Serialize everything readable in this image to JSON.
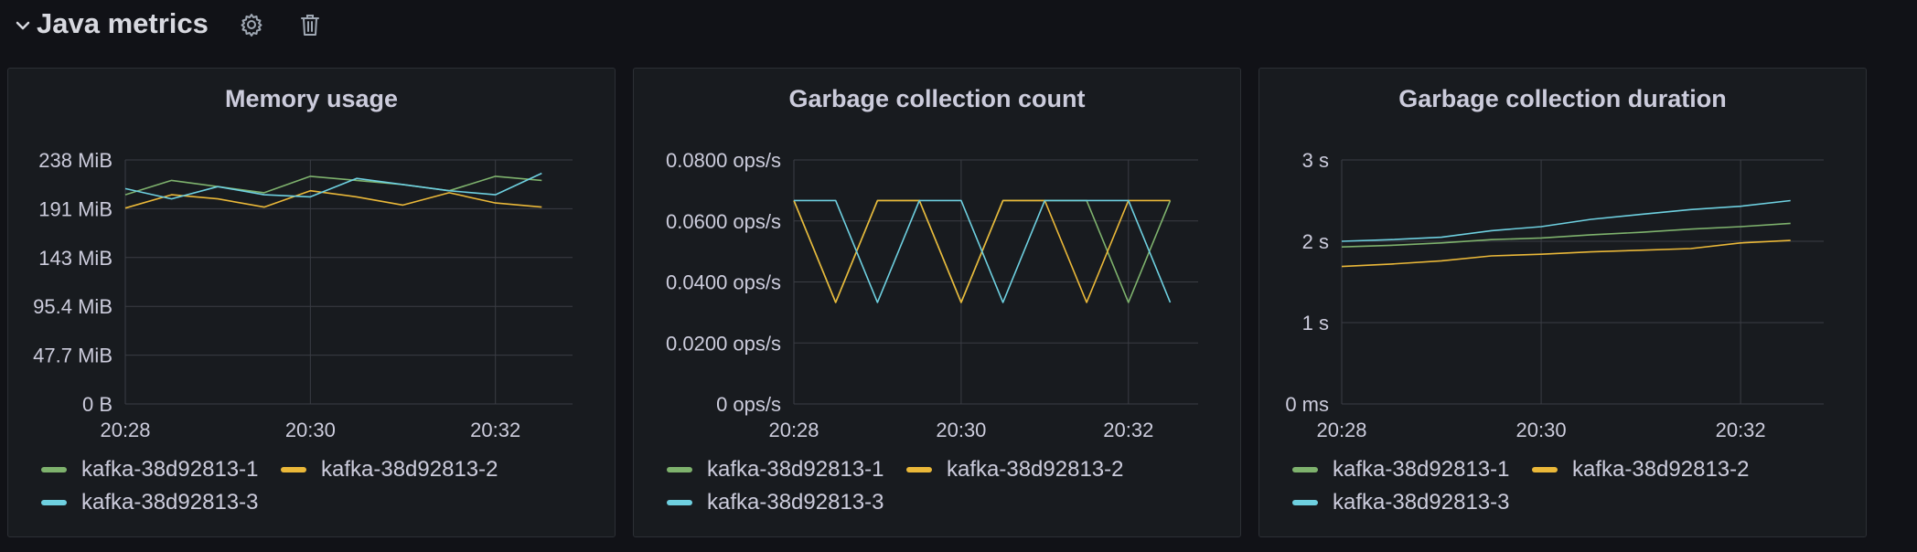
{
  "row": {
    "title": "Java metrics",
    "icons": [
      "chevron-down-icon",
      "gear-icon",
      "trash-icon"
    ]
  },
  "series_colors": [
    "#73bf69",
    "#f2cc0c",
    "#8ab8ff"
  ],
  "series_colors_actual": [
    "#7eb26d",
    "#eab839",
    "#6ed0e0"
  ],
  "panels": [
    {
      "title": "Memory usage",
      "legend": [
        "kafka-38d92813-1",
        "kafka-38d92813-2",
        "kafka-38d92813-3"
      ]
    },
    {
      "title": "Garbage collection count",
      "legend": [
        "kafka-38d92813-1",
        "kafka-38d92813-2",
        "kafka-38d92813-3"
      ]
    },
    {
      "title": "Garbage collection duration",
      "legend": [
        "kafka-38d92813-1",
        "kafka-38d92813-2",
        "kafka-38d92813-3"
      ]
    }
  ],
  "chart_data": [
    {
      "type": "line",
      "title": "Memory usage",
      "x_ticks": [
        "20:28",
        "20:30",
        "20:32"
      ],
      "y_ticks": [
        "0 B",
        "47.7 MiB",
        "95.4 MiB",
        "143 MiB",
        "191 MiB",
        "238 MiB"
      ],
      "ylim": [
        0,
        238
      ],
      "x_range": [
        "20:28",
        "20:32:30"
      ],
      "grid": true,
      "legend_position": "bottom",
      "x": [
        "20:28",
        "20:28:30",
        "20:29",
        "20:29:30",
        "20:30",
        "20:30:30",
        "20:31",
        "20:31:30",
        "20:32",
        "20:32:30"
      ],
      "series": [
        {
          "name": "kafka-38d92813-1",
          "values": [
            204,
            218,
            212,
            206,
            222,
            218,
            214,
            208,
            222,
            218
          ]
        },
        {
          "name": "kafka-38d92813-2",
          "values": [
            191,
            204,
            200,
            192,
            208,
            202,
            194,
            206,
            196,
            192
          ]
        },
        {
          "name": "kafka-38d92813-3",
          "values": [
            210,
            200,
            212,
            204,
            202,
            220,
            214,
            208,
            204,
            225
          ]
        }
      ]
    },
    {
      "type": "line",
      "title": "Garbage collection count",
      "x_ticks": [
        "20:28",
        "20:30",
        "20:32"
      ],
      "y_ticks": [
        "0 ops/s",
        "0.0200 ops/s",
        "0.0400 ops/s",
        "0.0600 ops/s",
        "0.0800 ops/s"
      ],
      "ylim": [
        0,
        0.08
      ],
      "x_range": [
        "20:28",
        "20:32:30"
      ],
      "grid": true,
      "legend_position": "bottom",
      "x": [
        "20:28",
        "20:28:30",
        "20:29",
        "20:29:30",
        "20:30",
        "20:30:30",
        "20:31",
        "20:31:30",
        "20:32",
        "20:32:30"
      ],
      "series": [
        {
          "name": "kafka-38d92813-1",
          "values": [
            0.0667,
            0.0333,
            0.0667,
            0.0667,
            0.0333,
            0.0667,
            0.0667,
            0.0667,
            0.0333,
            0.0667
          ]
        },
        {
          "name": "kafka-38d92813-2",
          "values": [
            0.0667,
            0.0333,
            0.0667,
            0.0667,
            0.0333,
            0.0667,
            0.0667,
            0.0333,
            0.0667,
            0.0667
          ]
        },
        {
          "name": "kafka-38d92813-3",
          "values": [
            0.0667,
            0.0667,
            0.0333,
            0.0667,
            0.0667,
            0.0333,
            0.0667,
            0.0667,
            0.0667,
            0.0333
          ]
        }
      ]
    },
    {
      "type": "line",
      "title": "Garbage collection duration",
      "x_ticks": [
        "20:28",
        "20:30",
        "20:32"
      ],
      "y_ticks": [
        "0 ms",
        "1 s",
        "2 s",
        "3 s"
      ],
      "ylim": [
        0,
        3
      ],
      "x_range": [
        "20:28",
        "20:32:30"
      ],
      "grid": true,
      "legend_position": "bottom",
      "x": [
        "20:28",
        "20:28:30",
        "20:29",
        "20:29:30",
        "20:30",
        "20:30:30",
        "20:31",
        "20:31:30",
        "20:32",
        "20:32:30"
      ],
      "series": [
        {
          "name": "kafka-38d92813-1",
          "values": [
            1.93,
            1.95,
            1.98,
            2.02,
            2.04,
            2.08,
            2.11,
            2.15,
            2.18,
            2.22
          ]
        },
        {
          "name": "kafka-38d92813-2",
          "values": [
            1.69,
            1.72,
            1.76,
            1.82,
            1.84,
            1.87,
            1.89,
            1.91,
            1.98,
            2.01
          ]
        },
        {
          "name": "kafka-38d92813-3",
          "values": [
            2.0,
            2.02,
            2.05,
            2.13,
            2.18,
            2.27,
            2.33,
            2.39,
            2.43,
            2.5
          ]
        }
      ]
    }
  ]
}
